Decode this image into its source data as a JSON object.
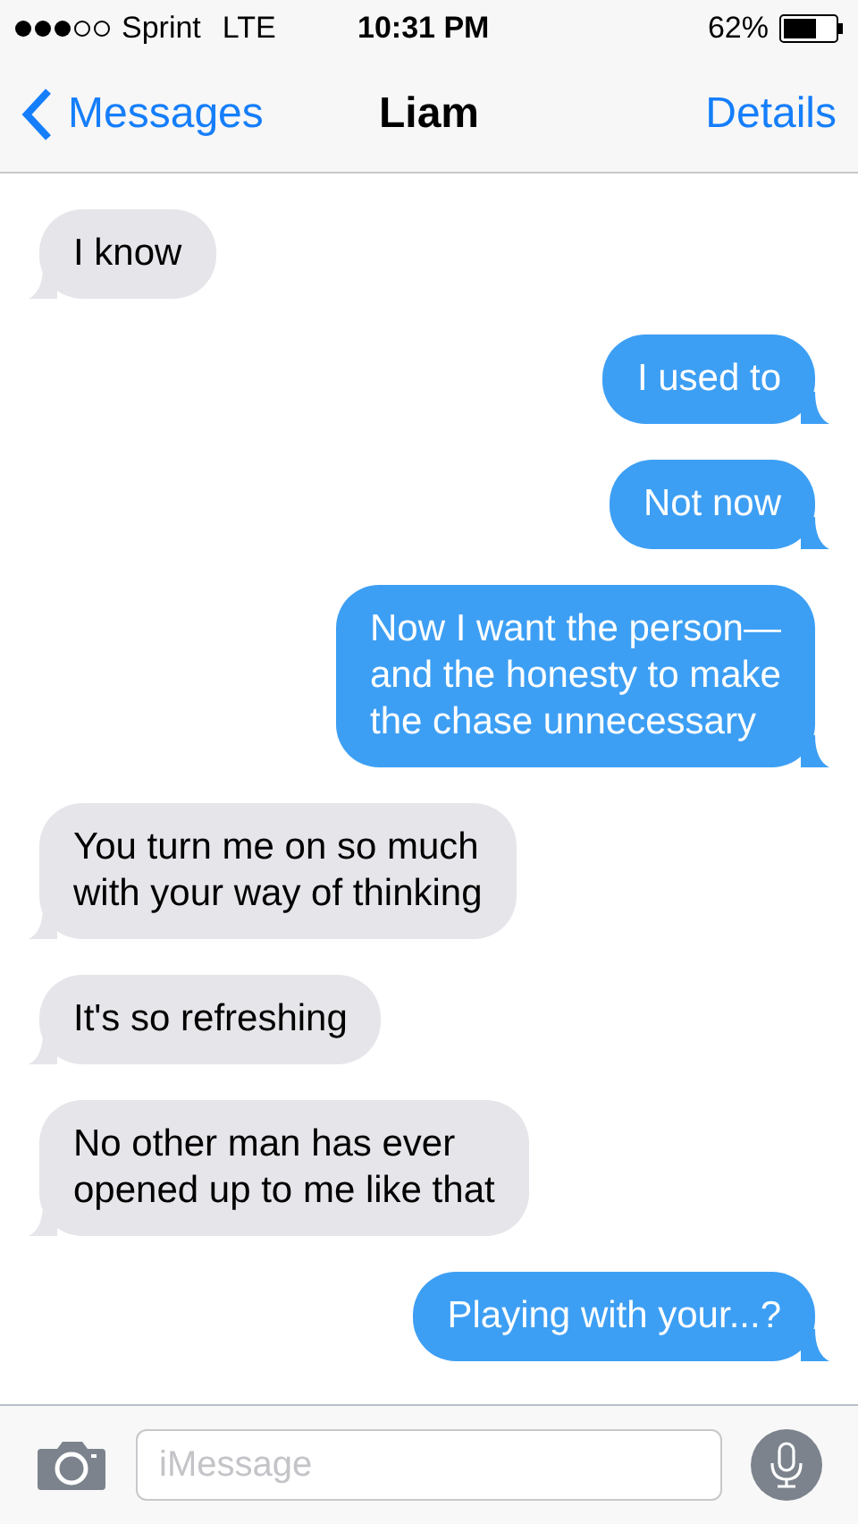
{
  "status_bar": {
    "carrier": "Sprint",
    "network": "LTE",
    "time": "10:31 PM",
    "battery": "62%"
  },
  "nav": {
    "back": "Messages",
    "title": "Liam",
    "action": "Details"
  },
  "messages": [
    {
      "kind": "incoming",
      "text": "I know"
    },
    {
      "kind": "outgoing",
      "text": "I used to"
    },
    {
      "kind": "outgoing",
      "text": "Not now"
    },
    {
      "kind": "outgoing",
      "text": "Now I want the person—\nand the honesty to make\nthe chase unnecessary"
    },
    {
      "kind": "incoming",
      "text": "You turn me on so much\nwith your way of thinking"
    },
    {
      "kind": "incoming",
      "text": "It's so refreshing"
    },
    {
      "kind": "incoming",
      "text": "No other man has ever\nopened up to me like that"
    },
    {
      "kind": "outgoing",
      "text": "Playing with your...?"
    }
  ],
  "composer": {
    "placeholder": "iMessage"
  }
}
